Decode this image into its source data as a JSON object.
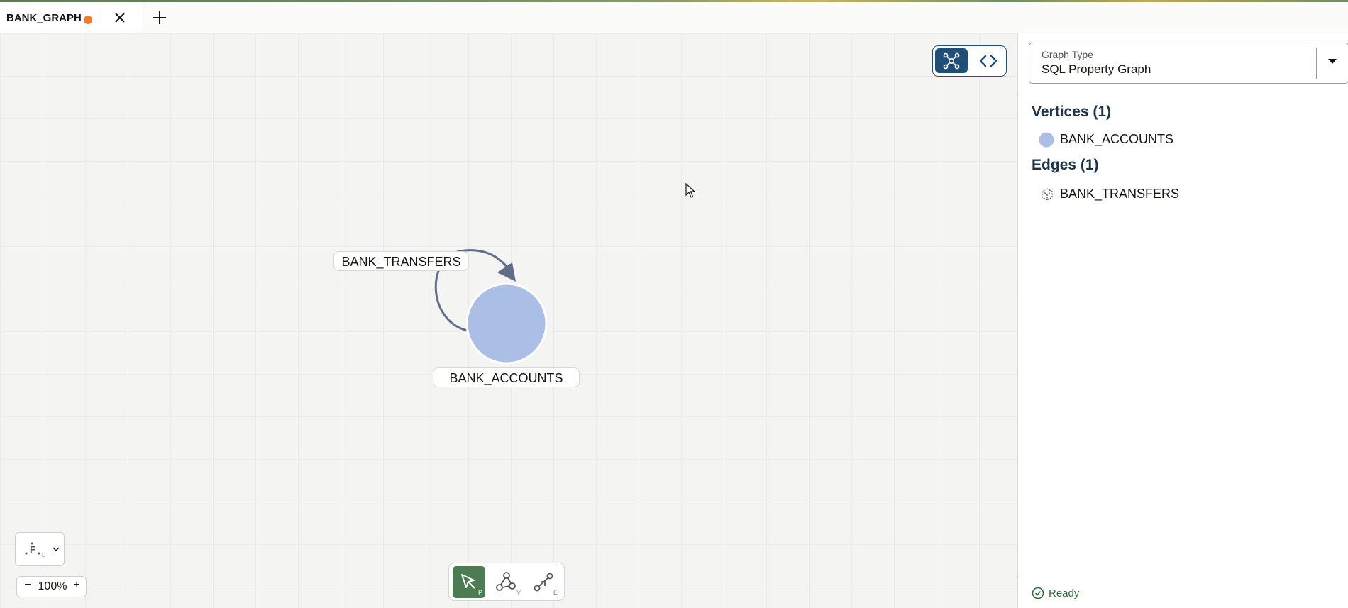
{
  "tab": {
    "title": "BANK_GRAPH",
    "unsaved": true,
    "unsaved_dot_color": "#f07b2b"
  },
  "canvas": {
    "nodes": [
      {
        "label": "BANK_ACCOUNTS",
        "color": "#aabee6"
      }
    ],
    "edges": [
      {
        "label": "BANK_TRANSFERS",
        "source": "BANK_ACCOUNTS",
        "target": "BANK_ACCOUNTS",
        "self_loop": true
      }
    ],
    "zoom": "100%",
    "view_mode": "graph",
    "active_tool": "pointer",
    "tool_shortcuts": {
      "pointer": "P",
      "vertex": "V",
      "edge": "E"
    },
    "layout_shortcut": "L"
  },
  "panel": {
    "graph_type_label": "Graph Type",
    "graph_type_value": "SQL Property Graph",
    "vertices_title": "Vertices (1)",
    "vertices": [
      {
        "label": "BANK_ACCOUNTS",
        "color": "#aabee6"
      }
    ],
    "edges_title": "Edges (1)",
    "edges": [
      {
        "label": "BANK_TRANSFERS"
      }
    ]
  },
  "status": {
    "text": "Ready",
    "color": "#2d6c38"
  },
  "colors": {
    "accent_blue": "#1f4e79",
    "active_tool_green": "#4c7d52",
    "edge_stroke": "#5f6e86"
  }
}
